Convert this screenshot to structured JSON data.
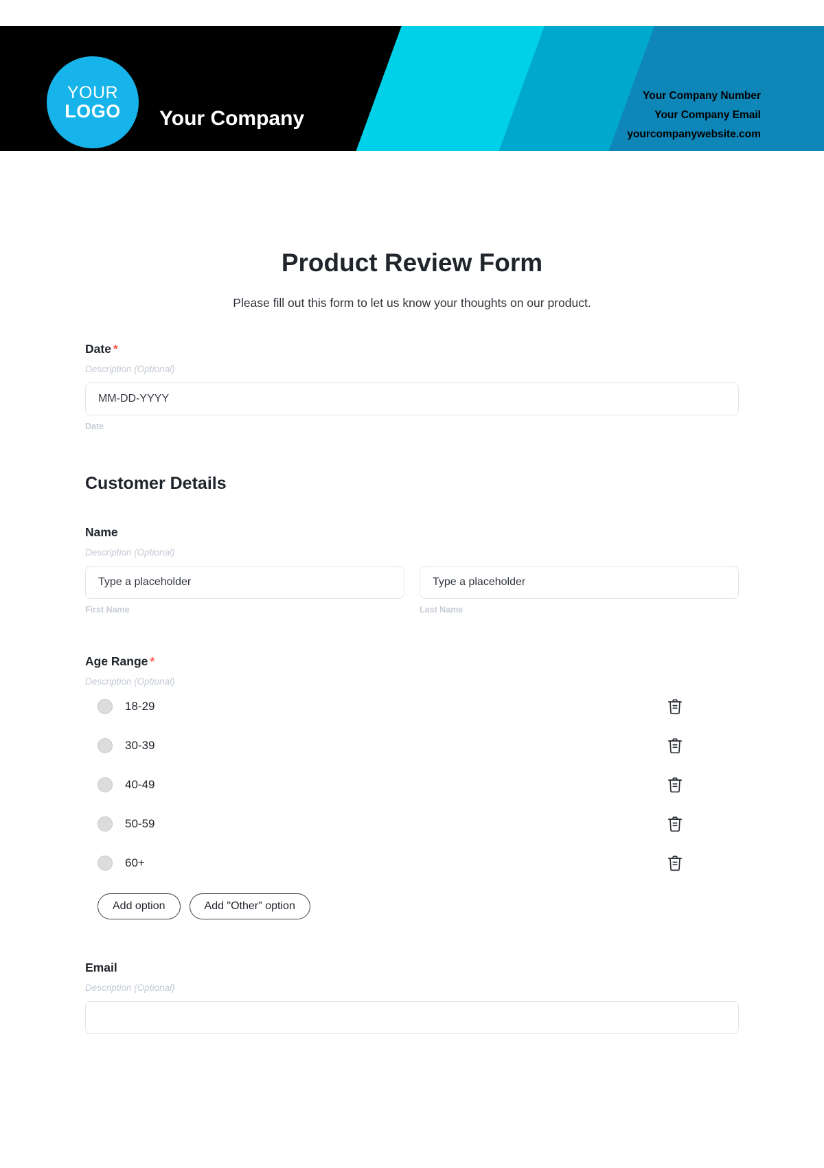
{
  "header": {
    "logo": {
      "line1": "YOUR",
      "line2": "LOGO",
      "circle_color": "#16B4EA"
    },
    "company_name": "Your Company",
    "contact": {
      "number": "Your Company Number",
      "email": "Your Company Email",
      "website": "yourcompanywebsite.com"
    },
    "background_color": "#000000",
    "band_colors": [
      "#00D1E8",
      "#00A8CE",
      "#0E86B8"
    ]
  },
  "form": {
    "title": "Product Review Form",
    "subtitle": "Please fill out this form to let us know your thoughts on our product.",
    "required_marker": "*",
    "description_placeholder": "Description (Optional)",
    "date_field": {
      "label": "Date",
      "required": true,
      "description": "Description (Optional)",
      "placeholder": "MM-DD-YYYY",
      "sub_label": "Date"
    },
    "section_heading": "Customer Details",
    "name_field": {
      "label": "Name",
      "required": false,
      "description": "Description (Optional)",
      "first": {
        "placeholder": "Type a placeholder",
        "sub_label": "First Name"
      },
      "last": {
        "placeholder": "Type a placeholder",
        "sub_label": "Last Name"
      }
    },
    "age_field": {
      "label": "Age Range",
      "required": true,
      "description": "Description (Optional)",
      "options": [
        "18-29",
        "30-39",
        "40-49",
        "50-59",
        "60+"
      ],
      "delete_icon": "trash-icon",
      "add_option_label": "Add option",
      "add_other_label": "Add \"Other\" option"
    },
    "email_field": {
      "label": "Email",
      "required": false,
      "description": "Description (Optional)"
    }
  }
}
